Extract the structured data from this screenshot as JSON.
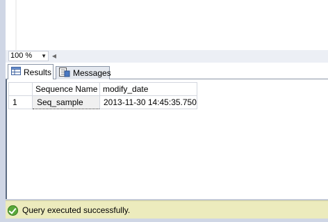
{
  "zoom": {
    "value": "100 %"
  },
  "tabs": [
    {
      "label": "Results",
      "icon": "grid-icon",
      "active": true
    },
    {
      "label": "Messages",
      "icon": "messages-icon",
      "active": false
    }
  ],
  "grid": {
    "columns": [
      "Sequence Name",
      "modify_date"
    ],
    "rows": [
      {
        "rownum": "1",
        "cells": [
          "Seq_sample",
          "2013-11-30 14:45:35.750"
        ]
      }
    ]
  },
  "status": {
    "text": "Query executed successfully.",
    "icon": "success-check-icon",
    "color": "#ecebbd"
  }
}
